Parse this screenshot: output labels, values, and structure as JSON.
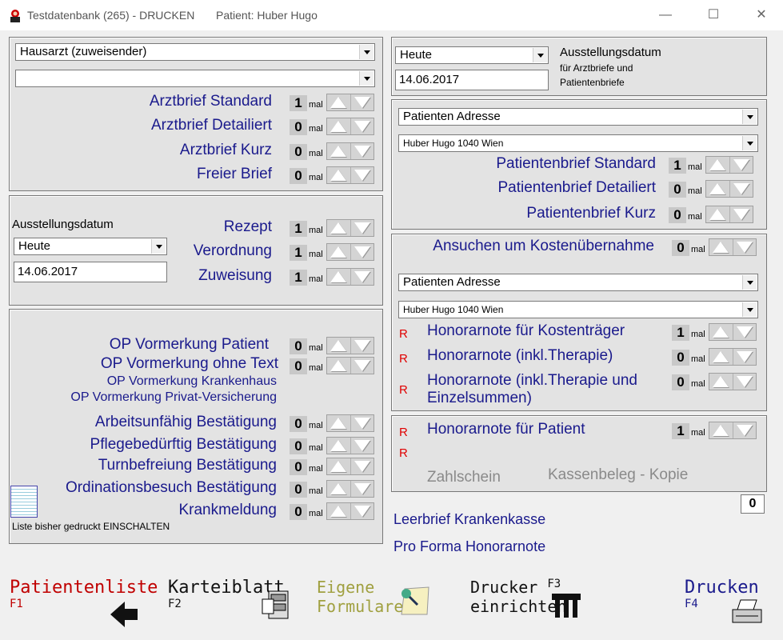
{
  "window": {
    "title": "Testdatenbank (265) - DRUCKEN",
    "patient": "Patient: Huber Hugo",
    "min": "—",
    "max": "☐",
    "close": "✕"
  },
  "left1": {
    "doctor_select": "Hausarzt (zuweisender)",
    "second_select": "",
    "rows": [
      {
        "label": "Arztbrief Standard",
        "count": "1"
      },
      {
        "label": "Arztbrief Detailiert",
        "count": "0"
      },
      {
        "label": "Arztbrief Kurz",
        "count": "0"
      },
      {
        "label": "Freier Brief",
        "count": "0"
      }
    ]
  },
  "mal": "mal",
  "left2": {
    "date_label": "Ausstellungsdatum",
    "date_select": "Heute",
    "date_value": "14.06.2017",
    "rows": [
      {
        "label": "Rezept",
        "count": "1"
      },
      {
        "label": "Verordnung",
        "count": "1"
      },
      {
        "label": "Zuweisung",
        "count": "1"
      }
    ]
  },
  "left3": {
    "op_patient": "OP Vormerkung   Patient",
    "op_patient_count": "0",
    "op_text": "OP Vormerkung ohne Text",
    "op_text_count": "0",
    "op_kh": "OP Vormerkung  Krankenhaus",
    "op_privat": "OP Vormerkung Privat-Versicherung",
    "rows": [
      {
        "label": "Arbeitsunfähig Bestätigung",
        "count": "0"
      },
      {
        "label": "Pflegebedürftig Bestätigung",
        "count": "0"
      },
      {
        "label": "Turnbefreiung Bestätigung",
        "count": "0"
      },
      {
        "label": "Ordinationsbesuch Bestätigung",
        "count": "0"
      },
      {
        "label": "Krankmeldung",
        "count": "0"
      }
    ],
    "list_toggle": "Liste bisher gedruckt EINSCHALTEN"
  },
  "right1": {
    "date_select": "Heute",
    "date_value": "14.06.2017",
    "date_label": "Ausstellungsdatum",
    "date_sub1": "für Arztbriefe und",
    "date_sub2": "Patientenbriefe"
  },
  "right2": {
    "address_select": "Patienten Adresse",
    "patient_select": "Huber Hugo   1040 Wien",
    "rows": [
      {
        "label": "Patientenbrief Standard",
        "count": "1"
      },
      {
        "label": "Patientenbrief Detailiert",
        "count": "0"
      },
      {
        "label": "Patientenbrief Kurz",
        "count": "0"
      }
    ]
  },
  "right3": {
    "ansuchen": "Ansuchen um Kostenübernahme",
    "ansuchen_count": "0",
    "address_select": "Patienten Adresse",
    "patient_select": "Huber Hugo   1040 Wien",
    "r": "R",
    "rows": [
      {
        "label": "Honorarnote für Kostenträger",
        "count": "1"
      },
      {
        "label": "Honorarnote (inkl.Therapie)",
        "count": "0"
      },
      {
        "label": "Honorarnote (inkl.Therapie und",
        "label2": "Einzelsummen)",
        "count": "0"
      }
    ]
  },
  "right4": {
    "row": {
      "label": "Honorarnote für Patient",
      "count": "1"
    },
    "zahlschein": "Zahlschein",
    "kassenbeleg": "Kassenbeleg - Kopie",
    "total": "0"
  },
  "links": {
    "leerbrief": "Leerbrief Krankenkasse",
    "proforma": "Pro Forma Honorarnote"
  },
  "footer": {
    "patientenliste": "Patientenliste",
    "patientenliste_key": "F1",
    "karteiblatt": "Karteiblatt",
    "karteiblatt_key": "F2",
    "eigene1": "Eigene",
    "eigene2": "Formulare",
    "drucker1": "Drucker",
    "drucker2": "einrichten",
    "drucker_key": "F3",
    "drucken": "Drucken",
    "drucken_key": "F4"
  },
  "colors": {
    "label": "#1a1a8c",
    "red": "#e00000",
    "olive": "#a0a040"
  }
}
